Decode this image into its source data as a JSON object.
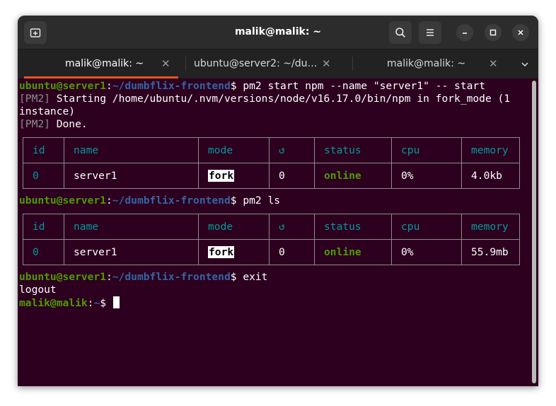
{
  "window": {
    "title": "malik@malik: ~",
    "new_tab_icon": "new-tab-icon",
    "search_icon": "search-icon",
    "menu_icon": "hamburger-menu-icon",
    "controls": {
      "minimize": "–",
      "maximize": "□",
      "close": "✕"
    }
  },
  "tabs": [
    {
      "label": "malik@malik: ~",
      "close": "✕",
      "active": true
    },
    {
      "label": "ubuntu@server2: ~/du…",
      "close": "✕",
      "active": false
    },
    {
      "label": "malik@malik: ~",
      "close": "✕",
      "active": false
    }
  ],
  "tabs_menu_icon": "chevron-down-icon",
  "accent_color": "#e95420",
  "terminal": {
    "background": "#2c001e",
    "prompt_user_color": "#4e9a06",
    "prompt_path_color": "#3465a4",
    "lines": {
      "l1": {
        "user": "ubuntu@server1",
        "colon": ":",
        "path": "~/dumbflix-frontend",
        "dollar": "$ ",
        "cmd": "pm2 start npm --name \"server1\" -- start"
      },
      "l2": {
        "tag": "[PM2]",
        "text": " Starting /home/ubuntu/.nvm/versions/node/v16.17.0/bin/npm in fork_mode (1"
      },
      "l3": {
        "text": "instance)"
      },
      "l4": {
        "tag": "[PM2]",
        "text": " Done."
      },
      "l5": {
        "user": "ubuntu@server1",
        "colon": ":",
        "path": "~/dumbflix-frontend",
        "dollar": "$ ",
        "cmd": "pm2 ls"
      },
      "l6": {
        "user": "ubuntu@server1",
        "colon": ":",
        "path": "~/dumbflix-frontend",
        "dollar": "$ ",
        "cmd": "exit"
      },
      "l7": {
        "text": "logout"
      },
      "l8": {
        "user": "malik@malik",
        "colon": ":",
        "path": "~",
        "dollar": "$ "
      }
    },
    "table_headers": {
      "id": "id",
      "name": "name",
      "mode": "mode",
      "restarts": "↺",
      "status": "status",
      "cpu": "cpu",
      "memory": "memory"
    },
    "table1": {
      "id": "0",
      "name": "server1",
      "mode": "fork",
      "restarts": "0",
      "status": "online",
      "cpu": "0%",
      "memory": "4.0kb"
    },
    "table2": {
      "id": "0",
      "name": "server1",
      "mode": "fork",
      "restarts": "0",
      "status": "online",
      "cpu": "0%",
      "memory": "55.9mb"
    }
  }
}
